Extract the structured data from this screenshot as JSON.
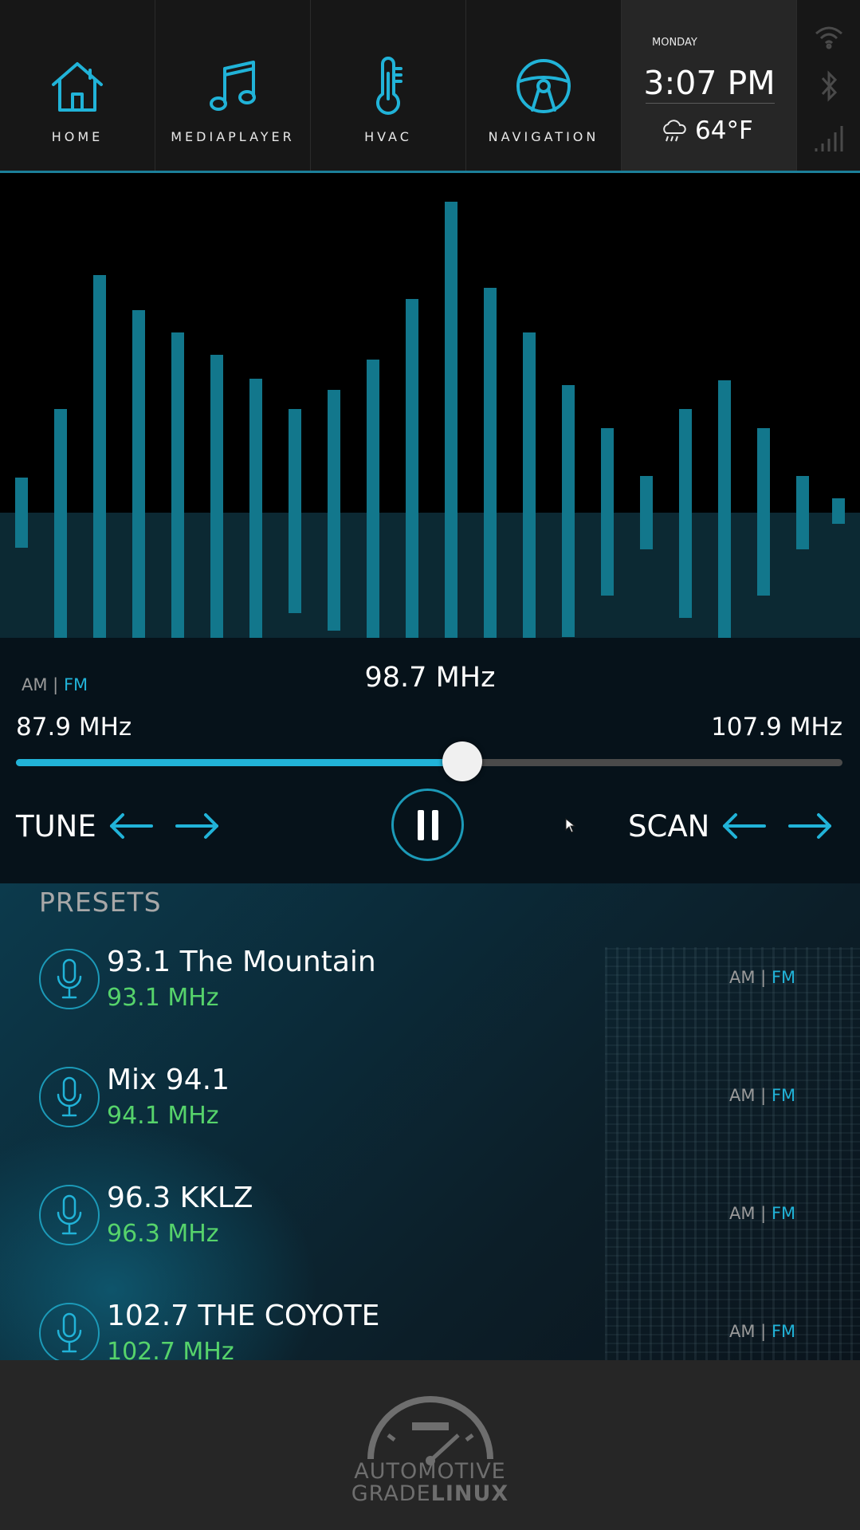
{
  "nav": {
    "items": [
      {
        "label": "HOME",
        "icon": "home-icon"
      },
      {
        "label": "MEDIAPLAYER",
        "icon": "music-note-icon"
      },
      {
        "label": "HVAC",
        "icon": "thermometer-icon"
      },
      {
        "label": "NAVIGATION",
        "icon": "steering-wheel-icon"
      }
    ]
  },
  "clock": {
    "day": "MONDAY",
    "time": "3:07 PM",
    "temperature": "64°F",
    "weather_icon": "rain-cloud-icon"
  },
  "status": {
    "icons": [
      "wifi-icon",
      "bluetooth-icon",
      "signal-bars-icon"
    ]
  },
  "tuner": {
    "band_am": "AM |",
    "band_fm": "FM",
    "current_frequency": "98.7 MHz",
    "min_label": "87.9 MHz",
    "max_label": "107.9 MHz",
    "slider_fraction": 0.54,
    "tune_label": "TUNE",
    "scan_label": "SCAN"
  },
  "presets": {
    "title": "PRESETS",
    "items": [
      {
        "name": "93.1 The Mountain",
        "frequency": "93.1 MHz",
        "band_am": "AM |",
        "band_fm": "FM"
      },
      {
        "name": "Mix 94.1",
        "frequency": "94.1 MHz",
        "band_am": "AM |",
        "band_fm": "FM"
      },
      {
        "name": "96.3 KKLZ",
        "frequency": "96.3 MHz",
        "band_am": "AM |",
        "band_fm": "FM"
      },
      {
        "name": "102.7 THE COYOTE",
        "frequency": "102.7 MHz",
        "band_am": "AM |",
        "band_fm": "FM"
      }
    ]
  },
  "footer": {
    "logo_line1": "AUTOMOTIVE",
    "logo_line2_a": "GRADE",
    "logo_line2_b": "LINUX"
  },
  "colors": {
    "accent": "#21b3d8",
    "frequency_green": "#56d36b",
    "topbar": "#171717"
  }
}
